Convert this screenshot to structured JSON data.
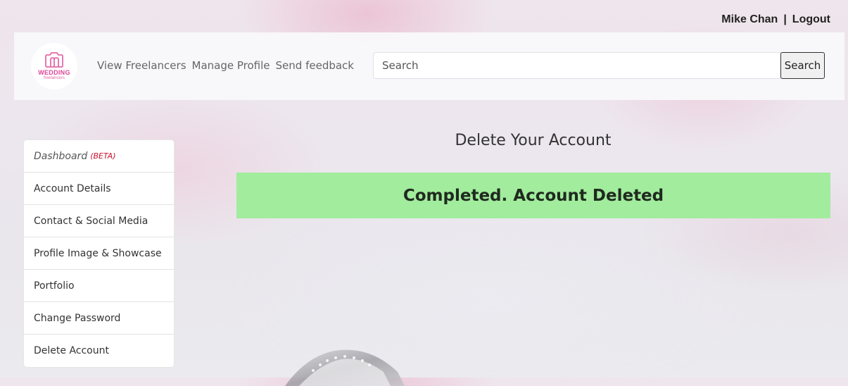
{
  "header": {
    "user_name": "Mike Chan",
    "separator": "|",
    "logout_label": "Logout"
  },
  "brand": {
    "logo_line1": "WEDDING",
    "logo_line2": "freelancers",
    "logo_icon": "camera-icon",
    "accent_color": "#e0459a"
  },
  "nav": {
    "links": [
      "View Freelancers",
      "Manage Profile",
      "Send feedback"
    ]
  },
  "search": {
    "placeholder": "Search",
    "value": "",
    "button_label": "Search"
  },
  "sidebar": {
    "dashboard_label": "Dashboard",
    "dashboard_badge": "(BETA)",
    "items": [
      "Account Details",
      "Contact & Social Media",
      "Profile Image & Showcase",
      "Portfolio",
      "Change Password",
      "Delete Account"
    ]
  },
  "main": {
    "title": "Delete Your Account",
    "alert_text": "Completed. Account Deleted",
    "alert_color": "#a1ec9d"
  }
}
